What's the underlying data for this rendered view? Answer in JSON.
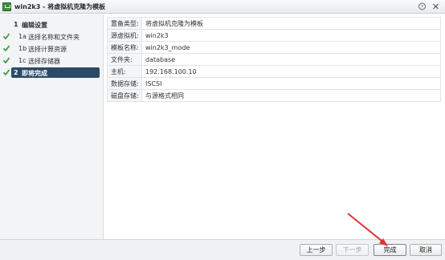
{
  "window": {
    "title": "win2k3 - 将虚拟机克隆为模板"
  },
  "steps": [
    {
      "num": "1",
      "label": "编辑设置",
      "checked": false
    },
    {
      "num": "1a",
      "label": "选择名称和文件夹",
      "checked": true
    },
    {
      "num": "1b",
      "label": "选择计算资源",
      "checked": true
    },
    {
      "num": "1c",
      "label": "选择存储器",
      "checked": true
    },
    {
      "num": "2",
      "label": "即将完成",
      "checked": true,
      "active": true
    }
  ],
  "summary": [
    {
      "key": "置备类型:",
      "value": "将虚拟机克隆为模板"
    },
    {
      "key": "源虚拟机:",
      "value": "win2k3"
    },
    {
      "key": "模板名称:",
      "value": "win2k3_mode"
    },
    {
      "key": "文件夹:",
      "value": "database"
    },
    {
      "key": "主机:",
      "value": "192.168.100.10"
    },
    {
      "key": "数据存储:",
      "value": "ISCSI"
    },
    {
      "key": "磁盘存储:",
      "value": "与源格式相同"
    }
  ],
  "buttons": {
    "back": "上一步",
    "next": "下一步",
    "finish": "完成",
    "cancel": "取消"
  },
  "colors": {
    "active_step": "#2c4a68",
    "check": "#3f9b3f",
    "annotation_arrow": "#e53030"
  },
  "icons": {
    "app": "vm-template-icon",
    "help": "help-icon",
    "close": "close-icon",
    "check": "check-icon"
  }
}
